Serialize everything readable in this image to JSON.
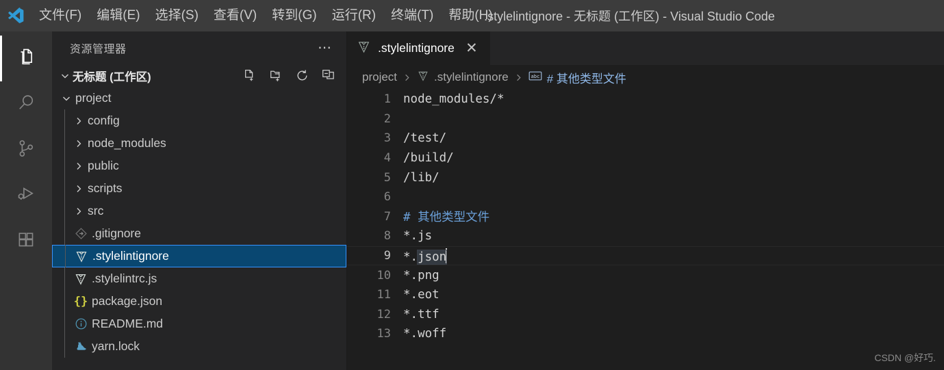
{
  "titlebar": {
    "logo_icon": "vscode-logo",
    "menus": [
      {
        "label": "文件(F)"
      },
      {
        "label": "编辑(E)"
      },
      {
        "label": "选择(S)"
      },
      {
        "label": "查看(V)"
      },
      {
        "label": "转到(G)"
      },
      {
        "label": "运行(R)"
      },
      {
        "label": "终端(T)"
      },
      {
        "label": "帮助(H)"
      }
    ],
    "window_title": ".stylelintignore - 无标题 (工作区) - Visual Studio Code"
  },
  "activitybar": {
    "items": [
      {
        "name": "explorer",
        "icon": "files-icon",
        "active": true
      },
      {
        "name": "search",
        "icon": "search-icon",
        "active": false
      },
      {
        "name": "source-control",
        "icon": "source-control-icon",
        "active": false
      },
      {
        "name": "run-debug",
        "icon": "run-and-debug-icon",
        "active": false
      },
      {
        "name": "extensions",
        "icon": "extensions-icon",
        "active": false
      }
    ]
  },
  "sidebar": {
    "title": "资源管理器",
    "more_icon": "ellipsis-icon",
    "workspace": {
      "label": "无标题 (工作区)",
      "expanded": true,
      "actions": [
        {
          "name": "new-file",
          "icon": "new-file-icon"
        },
        {
          "name": "new-folder",
          "icon": "new-folder-icon"
        },
        {
          "name": "refresh-explorer",
          "icon": "refresh-icon"
        },
        {
          "name": "collapse-folders",
          "icon": "collapse-all-icon"
        }
      ]
    },
    "tree": [
      {
        "label": "project",
        "depth": 1,
        "kind": "folder",
        "expanded": true,
        "icon": "chevron-down-icon",
        "selected": false
      },
      {
        "label": "config",
        "depth": 2,
        "kind": "folder",
        "expanded": false,
        "icon": "chevron-right-icon",
        "selected": false
      },
      {
        "label": "node_modules",
        "depth": 2,
        "kind": "folder",
        "expanded": false,
        "icon": "chevron-right-icon",
        "selected": false
      },
      {
        "label": "public",
        "depth": 2,
        "kind": "folder",
        "expanded": false,
        "icon": "chevron-right-icon",
        "selected": false
      },
      {
        "label": "scripts",
        "depth": 2,
        "kind": "folder",
        "expanded": false,
        "icon": "chevron-right-icon",
        "selected": false
      },
      {
        "label": "src",
        "depth": 2,
        "kind": "folder",
        "expanded": false,
        "icon": "chevron-right-icon",
        "selected": false
      },
      {
        "label": ".gitignore",
        "depth": 2,
        "kind": "file",
        "icon": "git-file-icon",
        "selected": false
      },
      {
        "label": ".stylelintignore",
        "depth": 2,
        "kind": "file",
        "icon": "stylelint-file-icon",
        "selected": true
      },
      {
        "label": ".stylelintrc.js",
        "depth": 2,
        "kind": "file",
        "icon": "stylelint-file-icon",
        "selected": false
      },
      {
        "label": "package.json",
        "depth": 2,
        "kind": "file",
        "icon": "json-file-icon",
        "selected": false
      },
      {
        "label": "README.md",
        "depth": 2,
        "kind": "file",
        "icon": "info-file-icon",
        "selected": false
      },
      {
        "label": "yarn.lock",
        "depth": 2,
        "kind": "file",
        "icon": "yarn-file-icon",
        "selected": false
      }
    ]
  },
  "editor": {
    "tab": {
      "label": ".stylelintignore",
      "icon": "stylelint-file-icon",
      "close_icon": "close-icon",
      "active": true
    },
    "breadcrumbs": [
      {
        "label": "project",
        "icon": null,
        "type": "folder"
      },
      {
        "label": ".stylelintignore",
        "icon": "stylelint-file-icon",
        "type": "file"
      },
      {
        "label": "# 其他类型文件",
        "icon": "symbol-string-icon",
        "type": "symbol"
      }
    ],
    "lines": [
      {
        "num": "1",
        "text": "node_modules/*",
        "style": "plain"
      },
      {
        "num": "2",
        "text": "",
        "style": "plain"
      },
      {
        "num": "3",
        "text": "/test/",
        "style": "plain"
      },
      {
        "num": "4",
        "text": "/build/",
        "style": "plain"
      },
      {
        "num": "5",
        "text": "/lib/",
        "style": "plain"
      },
      {
        "num": "6",
        "text": "",
        "style": "plain"
      },
      {
        "num": "7",
        "text": "# 其他类型文件",
        "style": "comment"
      },
      {
        "num": "8",
        "text": "*.js",
        "style": "plain"
      },
      {
        "num": "9",
        "text": "*.json",
        "style": "plain",
        "current": true,
        "highlight_from": 2
      },
      {
        "num": "10",
        "text": "*.png",
        "style": "plain"
      },
      {
        "num": "11",
        "text": "*.eot",
        "style": "plain"
      },
      {
        "num": "12",
        "text": "*.ttf",
        "style": "plain"
      },
      {
        "num": "13",
        "text": "*.woff",
        "style": "plain"
      }
    ]
  },
  "watermark": "CSDN @好巧.",
  "colors": {
    "titlebar_bg": "#3c3c3c",
    "activitybar_bg": "#333333",
    "sidebar_bg": "#252526",
    "editor_bg": "#1e1e1e",
    "selection_bg": "#094771",
    "focus_border": "#3794ff",
    "comment_blue": "#6a9fd8",
    "text": "#cccccc"
  }
}
